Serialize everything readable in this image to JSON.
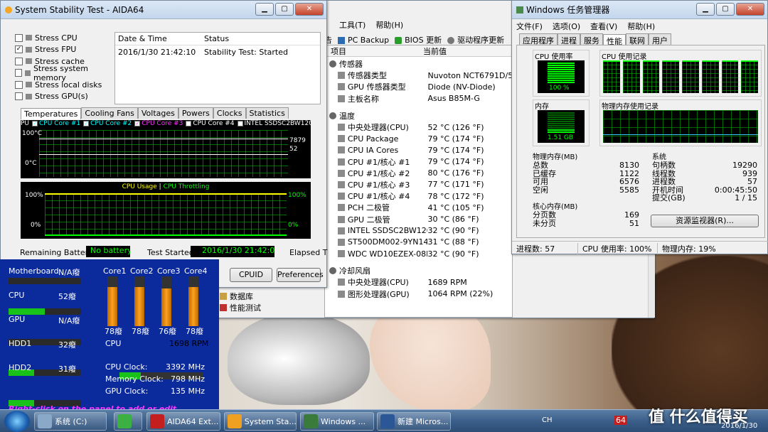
{
  "aida_stability": {
    "title": "System Stability Test - AIDA64",
    "stress": [
      {
        "label": "Stress CPU",
        "checked": false
      },
      {
        "label": "Stress FPU",
        "checked": true
      },
      {
        "label": "Stress cache",
        "checked": false
      },
      {
        "label": "Stress system memory",
        "checked": false
      },
      {
        "label": "Stress local disks",
        "checked": false
      },
      {
        "label": "Stress GPU(s)",
        "checked": false
      }
    ],
    "log": {
      "col1": "Date & Time",
      "col2": "Status",
      "date": "2016/1/30 21:42:10",
      "status": "Stability Test: Started"
    },
    "tabs": [
      "Temperatures",
      "Cooling Fans",
      "Voltages",
      "Powers",
      "Clocks",
      "Statistics"
    ],
    "temp_legend": [
      "PU",
      "CPU Core #1",
      "CPU Core #2",
      "CPU Core #3",
      "CPU Core #4",
      "INTEL SSDSC2BW120A"
    ],
    "temp_axis": {
      "top": "100°C",
      "bottom": "0°C",
      "val1": "7879",
      "val2": "52"
    },
    "usage_title_a": "CPU Usage",
    "usage_title_sep": "|",
    "usage_title_b": "CPU Throttling",
    "usage_axis": {
      "top": "100%",
      "bottom": "0%"
    },
    "battery_label": "Remaining Battery:",
    "battery_value": "No battery",
    "started_label": "Test Started:",
    "started_value": "2016/1/30 21:42:09",
    "elapsed_label": "Elapsed T",
    "cpuid_btn": "CPUID",
    "pref_btn": "Preferences",
    "colors": {
      "green": "#00ff00",
      "cyan": "#00ffff",
      "magenta": "#ff33ff",
      "yellow": "#ffff00"
    }
  },
  "aida_main": {
    "menu": [
      "工具(T)",
      "帮助(H)"
    ],
    "toolbar": [
      "告",
      "PC Backup",
      "BIOS 更新",
      "驱动程序更新"
    ],
    "col_item": "项目",
    "col_value": "当前值",
    "groups": [
      {
        "title": "传感器",
        "rows": [
          {
            "label": "传感器类型",
            "value": "Nuvoton NCT6791D/5538"
          },
          {
            "label": "GPU 传感器类型",
            "value": "Diode (NV-Diode)"
          },
          {
            "label": "主板名称",
            "value": "Asus B85M-G"
          }
        ]
      },
      {
        "title": "温度",
        "rows": [
          {
            "label": "中央处理器(CPU)",
            "value": "52 °C (126 °F)"
          },
          {
            "label": "CPU Package",
            "value": "79 °C (174 °F)"
          },
          {
            "label": "CPU IA Cores",
            "value": "79 °C (174 °F)"
          },
          {
            "label": "CPU #1/核心 #1",
            "value": "79 °C (174 °F)"
          },
          {
            "label": "CPU #1/核心 #2",
            "value": "80 °C (176 °F)"
          },
          {
            "label": "CPU #1/核心 #3",
            "value": "77 °C (171 °F)"
          },
          {
            "label": "CPU #1/核心 #4",
            "value": "78 °C (172 °F)"
          },
          {
            "label": "PCH 二极管",
            "value": "41 °C (105 °F)"
          },
          {
            "label": "GPU 二极管",
            "value": "30 °C (86 °F)"
          },
          {
            "label": "INTEL SSDSC2BW120A4",
            "value": "32 °C (90 °F)"
          },
          {
            "label": "ST500DM002-9YN14C",
            "value": "31 °C (88 °F)"
          },
          {
            "label": "WDC WD10EZEX-08M...",
            "value": "32 °C (90 °F)"
          }
        ]
      },
      {
        "title": "冷却风扇",
        "rows": [
          {
            "label": "中央处理器(CPU)",
            "value": "1689 RPM"
          },
          {
            "label": "图形处理器(GPU)",
            "value": "1064 RPM  (22%)"
          }
        ]
      }
    ],
    "tree": [
      "数据库",
      "性能测试"
    ]
  },
  "taskmgr": {
    "title": "Windows 任务管理器",
    "menu": [
      "文件(F)",
      "选项(O)",
      "查看(V)",
      "帮助(H)"
    ],
    "tabs": [
      "应用程序",
      "进程",
      "服务",
      "性能",
      "联网",
      "用户"
    ],
    "cpu_usage_label": "CPU 使用率",
    "cpu_usage_value": "100 %",
    "cpu_hist_label": "CPU 使用记录",
    "mem_label": "内存",
    "mem_value": "1.51 GB",
    "mem_hist_label": "物理内存使用记录",
    "phys_title": "物理内存(MB)",
    "phys": [
      {
        "k": "总数",
        "v": "8130"
      },
      {
        "k": "已缓存",
        "v": "1122"
      },
      {
        "k": "可用",
        "v": "6576"
      },
      {
        "k": "空闲",
        "v": "5585"
      }
    ],
    "sys_title": "系统",
    "sys": [
      {
        "k": "句柄数",
        "v": "19290"
      },
      {
        "k": "线程数",
        "v": "939"
      },
      {
        "k": "进程数",
        "v": "57"
      },
      {
        "k": "开机时间",
        "v": "0:00:45:50"
      },
      {
        "k": "提交(GB)",
        "v": "1 / 15"
      }
    ],
    "kern_title": "核心内存(MB)",
    "kern": [
      {
        "k": "分页数",
        "v": "169"
      },
      {
        "k": "未分页",
        "v": "51"
      }
    ],
    "monitor_btn": "资源监视器(R)...",
    "status": {
      "proc": "进程数: 57",
      "cpu": "CPU 使用率: 100%",
      "mem": "物理内存: 19%"
    },
    "cpu_usage_pct": 100,
    "mem_usage_pct": 19
  },
  "sensorpanel": {
    "rows": [
      {
        "label": "Motherboard",
        "value": "N/A癈",
        "fill": 0
      },
      {
        "label": "CPU",
        "value": "52癈",
        "fill": 0.5
      },
      {
        "label": "GPU",
        "value": "N/A癈",
        "fill": 0
      },
      {
        "label": "HDD1",
        "value": "32癈",
        "fill": 0.35
      },
      {
        "label": "HDD2",
        "value": "31癈",
        "fill": 0.35
      }
    ],
    "cores": [
      {
        "label": "Core1",
        "value": "78癈",
        "fill": 0.78
      },
      {
        "label": "Core2",
        "value": "78癈",
        "fill": 0.78
      },
      {
        "label": "Core3",
        "value": "76癈",
        "fill": 0.76
      },
      {
        "label": "Core4",
        "value": "78癈",
        "fill": 0.78
      }
    ],
    "cpu_fan_label": "CPU",
    "cpu_fan_value": "1698 RPM",
    "cpu_fan_fill": 0.25,
    "clocks": [
      {
        "label": "CPU Clock:",
        "value": "3392 MHz"
      },
      {
        "label": "Memory Clock:",
        "value": "798 MHz"
      },
      {
        "label": "GPU Clock:",
        "value": "135 MHz"
      }
    ],
    "hint": "Right-click on the panel to add or edit SensorPan"
  },
  "taskbar": {
    "items": [
      {
        "label": "系统 (C:)",
        "color": "#8aa8c8"
      },
      {
        "label": "",
        "color": "#3cb043"
      },
      {
        "label": "AIDA64 Ext...",
        "color": "#c41e1e"
      },
      {
        "label": "System Sta...",
        "color": "#f0a020"
      },
      {
        "label": "Windows ...",
        "color": "#3a7a3a"
      },
      {
        "label": "新建 Micros...",
        "color": "#2b5797"
      }
    ],
    "ime": "CH",
    "badge": "64",
    "date": "2016/1/30",
    "watermark": "值 什么值得买"
  }
}
